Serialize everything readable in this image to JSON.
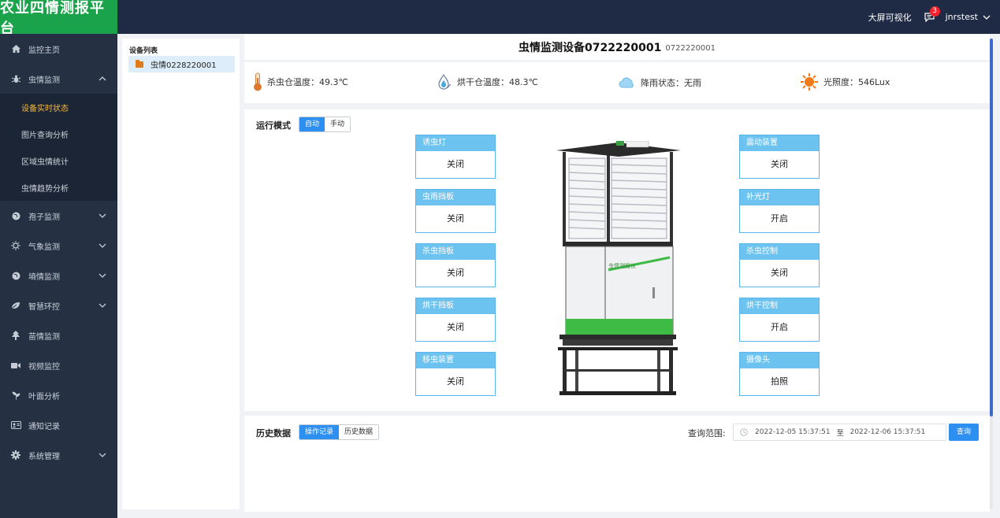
{
  "app": {
    "title": "农业四情测报平台"
  },
  "topbar": {
    "bigscreen": "大屏可视化",
    "msg_count": "3",
    "username": "jnrstest"
  },
  "sidebar": {
    "items": [
      {
        "label": "监控主页",
        "icon": "home-icon"
      },
      {
        "label": "虫情监测",
        "icon": "bug-icon",
        "expanded": true
      },
      {
        "label": "孢子监测",
        "icon": "globe-icon"
      },
      {
        "label": "气象监测",
        "icon": "sun-icon"
      },
      {
        "label": "墒情监测",
        "icon": "globe-icon"
      },
      {
        "label": "智慧环控",
        "icon": "leaf-icon"
      },
      {
        "label": "苗情监测",
        "icon": "tree-icon"
      },
      {
        "label": "视频监控",
        "icon": "video-icon"
      },
      {
        "label": "叶面分析",
        "icon": "seedling-icon"
      },
      {
        "label": "通知记录",
        "icon": "id-card-icon"
      },
      {
        "label": "系统管理",
        "icon": "gear-icon"
      }
    ],
    "sub_items": [
      "设备实时状态",
      "图片查询分析",
      "区域虫情统计",
      "虫情趋势分析"
    ],
    "active_sub": "设备实时状态"
  },
  "device_list": {
    "title": "设备列表",
    "items": [
      "虫情0228220001"
    ]
  },
  "device": {
    "name": "虫情监测设备0722220001",
    "code": "0722220001"
  },
  "status": {
    "kill_temp": "杀虫仓温度：49.3℃",
    "dry_temp": "烘干仓温度：48.3℃",
    "rain": "降雨状态：无雨",
    "light": "光照度：546Lux"
  },
  "mode": {
    "label": "运行模式",
    "options": [
      "自动",
      "手动"
    ],
    "selected": "自动"
  },
  "controls_left": [
    {
      "title": "诱虫灯",
      "state": "关闭"
    },
    {
      "title": "虫雨挡板",
      "state": "关闭"
    },
    {
      "title": "杀虫挡板",
      "state": "关闭"
    },
    {
      "title": "烘干挡板",
      "state": "关闭"
    },
    {
      "title": "移虫装置",
      "state": "关闭"
    }
  ],
  "controls_right": [
    {
      "title": "震动装置",
      "state": "关闭"
    },
    {
      "title": "补光灯",
      "state": "开启"
    },
    {
      "title": "杀虫控制",
      "state": "关闭"
    },
    {
      "title": "烘干控制",
      "state": "开启"
    },
    {
      "title": "摄像头",
      "state": "拍照"
    }
  ],
  "device_image": {
    "label": "虫情测报仪"
  },
  "history": {
    "label": "历史数据",
    "tabs": [
      "操作记录",
      "历史数据"
    ],
    "selected": "操作记录",
    "range_label": "查询范围:",
    "start": "2022-12-05 15:37:51",
    "range_sep": "至",
    "end": "2022-12-06 15:37:51",
    "query_label": "查询"
  },
  "colors": {
    "brand_green": "#1aa34a",
    "nav_bg": "#253043",
    "accent_blue": "#2d8ff0",
    "card_header": "#6cc3f0",
    "active_sub": "#f5b942"
  }
}
